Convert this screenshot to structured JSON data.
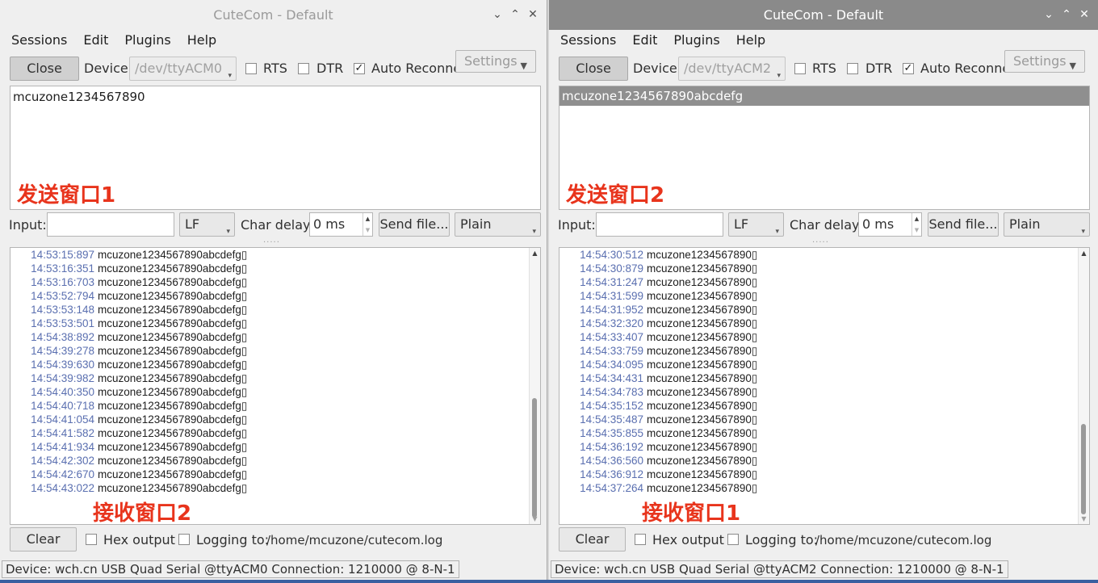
{
  "windows": [
    {
      "title": "CuteCom - Default",
      "menu": [
        "Sessions",
        "Edit",
        "Plugins",
        "Help"
      ],
      "close_label": "Close",
      "device_label": "Device:",
      "device_value": "/dev/ttyACM0",
      "rts_label": "RTS",
      "dtr_label": "DTR",
      "auto_reconnect_label": "Auto Reconnect",
      "settings_label": "Settings",
      "send_text": "mcuzone1234567890",
      "send_selected": false,
      "overlay_send": "发送窗口1",
      "input_label": "Input:",
      "input_value": "",
      "line_end": "LF",
      "char_delay_label": "Char delay:",
      "char_delay_value": "0 ms",
      "send_file_label": "Send file...",
      "format": "Plain",
      "recv_lines": [
        [
          "14:53:15:897",
          "mcuzone1234567890abcdefg▯"
        ],
        [
          "14:53:16:351",
          "mcuzone1234567890abcdefg▯"
        ],
        [
          "14:53:16:703",
          "mcuzone1234567890abcdefg▯"
        ],
        [
          "14:53:52:794",
          "mcuzone1234567890abcdefg▯"
        ],
        [
          "14:53:53:148",
          "mcuzone1234567890abcdefg▯"
        ],
        [
          "14:53:53:501",
          "mcuzone1234567890abcdefg▯"
        ],
        [
          "14:54:38:892",
          "mcuzone1234567890abcdefg▯"
        ],
        [
          "14:54:39:278",
          "mcuzone1234567890abcdefg▯"
        ],
        [
          "14:54:39:630",
          "mcuzone1234567890abcdefg▯"
        ],
        [
          "14:54:39:982",
          "mcuzone1234567890abcdefg▯"
        ],
        [
          "14:54:40:350",
          "mcuzone1234567890abcdefg▯"
        ],
        [
          "14:54:40:718",
          "mcuzone1234567890abcdefg▯"
        ],
        [
          "14:54:41:054",
          "mcuzone1234567890abcdefg▯"
        ],
        [
          "14:54:41:582",
          "mcuzone1234567890abcdefg▯"
        ],
        [
          "14:54:41:934",
          "mcuzone1234567890abcdefg▯"
        ],
        [
          "14:54:42:302",
          "mcuzone1234567890abcdefg▯"
        ],
        [
          "14:54:42:670",
          "mcuzone1234567890abcdefg▯"
        ],
        [
          "14:54:43:022",
          "mcuzone1234567890abcdefg▯"
        ]
      ],
      "overlay_recv": "接收窗口2",
      "clear_label": "Clear",
      "hex_output_label": "Hex output",
      "logging_label": "Logging to:",
      "log_path": "/home/mcuzone/cutecom.log",
      "status": "Device:  wch.cn USB Quad Serial @ttyACM0  Connection:  1210000 @ 8-N-1"
    },
    {
      "title": "CuteCom - Default",
      "menu": [
        "Sessions",
        "Edit",
        "Plugins",
        "Help"
      ],
      "close_label": "Close",
      "device_label": "Device:",
      "device_value": "/dev/ttyACM2",
      "rts_label": "RTS",
      "dtr_label": "DTR",
      "auto_reconnect_label": "Auto Reconnect",
      "settings_label": "Settings",
      "send_text": "mcuzone1234567890abcdefg",
      "send_selected": true,
      "overlay_send": "发送窗口2",
      "input_label": "Input:",
      "input_value": "",
      "line_end": "LF",
      "char_delay_label": "Char delay:",
      "char_delay_value": "0 ms",
      "send_file_label": "Send file...",
      "format": "Plain",
      "recv_lines": [
        [
          "14:54:30:512",
          "mcuzone1234567890▯"
        ],
        [
          "14:54:30:879",
          "mcuzone1234567890▯"
        ],
        [
          "14:54:31:247",
          "mcuzone1234567890▯"
        ],
        [
          "14:54:31:599",
          "mcuzone1234567890▯"
        ],
        [
          "14:54:31:952",
          "mcuzone1234567890▯"
        ],
        [
          "14:54:32:320",
          "mcuzone1234567890▯"
        ],
        [
          "14:54:33:407",
          "mcuzone1234567890▯"
        ],
        [
          "14:54:33:759",
          "mcuzone1234567890▯"
        ],
        [
          "14:54:34:095",
          "mcuzone1234567890▯"
        ],
        [
          "14:54:34:431",
          "mcuzone1234567890▯"
        ],
        [
          "14:54:34:783",
          "mcuzone1234567890▯"
        ],
        [
          "14:54:35:152",
          "mcuzone1234567890▯"
        ],
        [
          "14:54:35:487",
          "mcuzone1234567890▯"
        ],
        [
          "14:54:35:855",
          "mcuzone1234567890▯"
        ],
        [
          "14:54:36:192",
          "mcuzone1234567890▯"
        ],
        [
          "14:54:36:560",
          "mcuzone1234567890▯"
        ],
        [
          "14:54:36:912",
          "mcuzone1234567890▯"
        ],
        [
          "14:54:37:264",
          "mcuzone1234567890▯"
        ]
      ],
      "overlay_recv": "接收窗口1",
      "clear_label": "Clear",
      "hex_output_label": "Hex output",
      "logging_label": "Logging to:",
      "log_path": "/home/mcuzone/cutecom.log",
      "status": "Device:  wch.cn USB Quad Serial @ttyACM2  Connection:  1210000 @ 8-N-1"
    }
  ],
  "icons": {
    "minimize": "chevron-down-icon",
    "maximize": "chevron-up-icon",
    "close": "close-icon",
    "checkmark": "check-icon"
  }
}
